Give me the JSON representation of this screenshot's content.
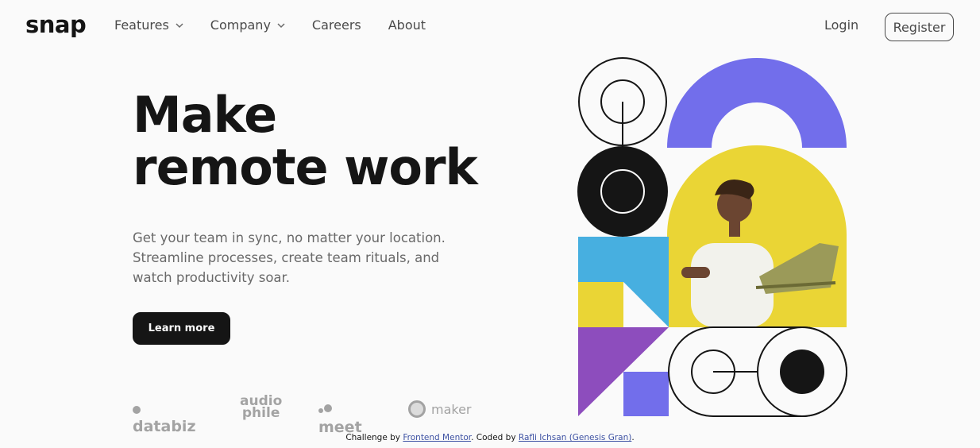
{
  "header": {
    "logo": "snap",
    "nav": [
      {
        "label": "Features",
        "has_dropdown": true,
        "icon": "chevron-down-icon"
      },
      {
        "label": "Company",
        "has_dropdown": true,
        "icon": "chevron-down-icon"
      },
      {
        "label": "Careers",
        "has_dropdown": false
      },
      {
        "label": "About",
        "has_dropdown": false
      }
    ],
    "login": "Login",
    "register": "Register"
  },
  "hero": {
    "headline_line1": "Make",
    "headline_line2": "remote work",
    "subtext_line1": "Get your team in sync, no matter your location.",
    "subtext_line2": "Streamline processes, create team rituals, and",
    "subtext_line3": "watch productivity soar.",
    "cta": "Learn more"
  },
  "clients": {
    "databiz": "databiz",
    "audiophile_top": "audio",
    "audiophile_bottom": "phile",
    "meet": "meet",
    "maker": "maker"
  },
  "footer": {
    "prefix": "Challenge by",
    "link1": "Frontend Mentor",
    "middle": ". Coded by",
    "link2": "Rafli Ichsan (Genesis Gran)",
    "suffix": "."
  },
  "colors": {
    "background": "#fafafa",
    "text": "#151515",
    "gray": "#696969",
    "purple": "#726eeb",
    "yellow": "#ead535",
    "blue": "#47afe0",
    "violet": "#8d4dbd"
  }
}
